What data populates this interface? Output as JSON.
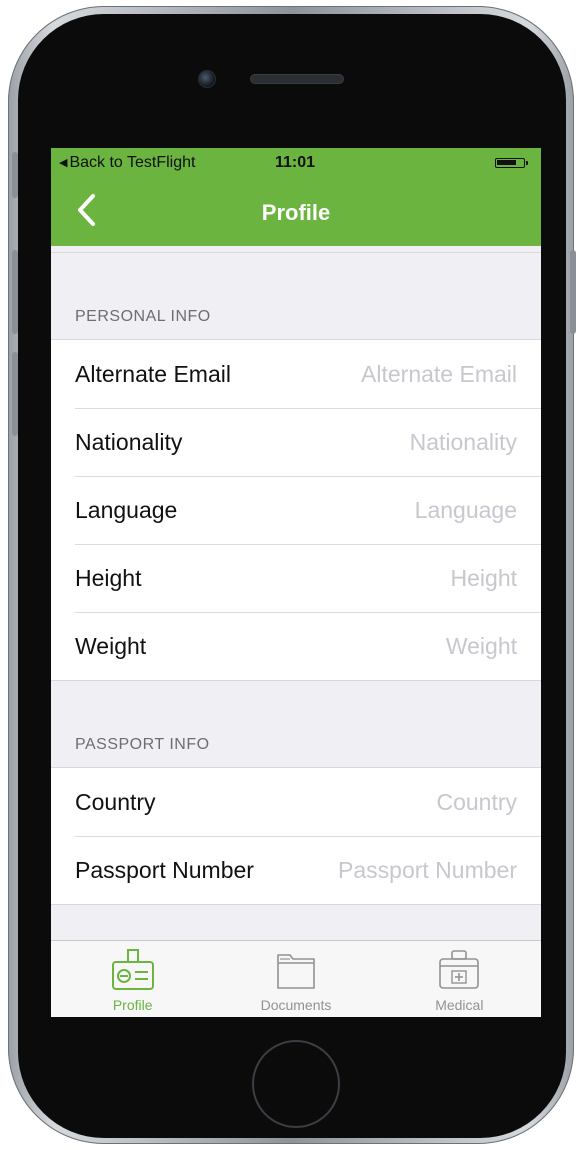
{
  "status_bar": {
    "back_app": "Back to TestFlight",
    "time": "11:01"
  },
  "nav": {
    "title": "Profile"
  },
  "personal_info": {
    "header": "PERSONAL INFO",
    "rows": [
      {
        "label": "Alternate Email",
        "placeholder": "Alternate Email"
      },
      {
        "label": "Nationality",
        "placeholder": "Nationality"
      },
      {
        "label": "Language",
        "placeholder": "Language"
      },
      {
        "label": "Height",
        "placeholder": "Height"
      },
      {
        "label": "Weight",
        "placeholder": "Weight"
      }
    ]
  },
  "passport_info": {
    "header": "PASSPORT INFO",
    "rows": [
      {
        "label": "Country",
        "placeholder": "Country"
      },
      {
        "label": "Passport Number",
        "placeholder": "Passport Number"
      }
    ]
  },
  "tabs": [
    {
      "label": "Profile",
      "icon": "id-badge-icon",
      "active": true
    },
    {
      "label": "Documents",
      "icon": "folder-icon",
      "active": false
    },
    {
      "label": "Medical",
      "icon": "medical-kit-icon",
      "active": false
    }
  ],
  "colors": {
    "accent": "#6ab43f",
    "tab_inactive": "#929292",
    "placeholder": "#c7c7cd"
  }
}
